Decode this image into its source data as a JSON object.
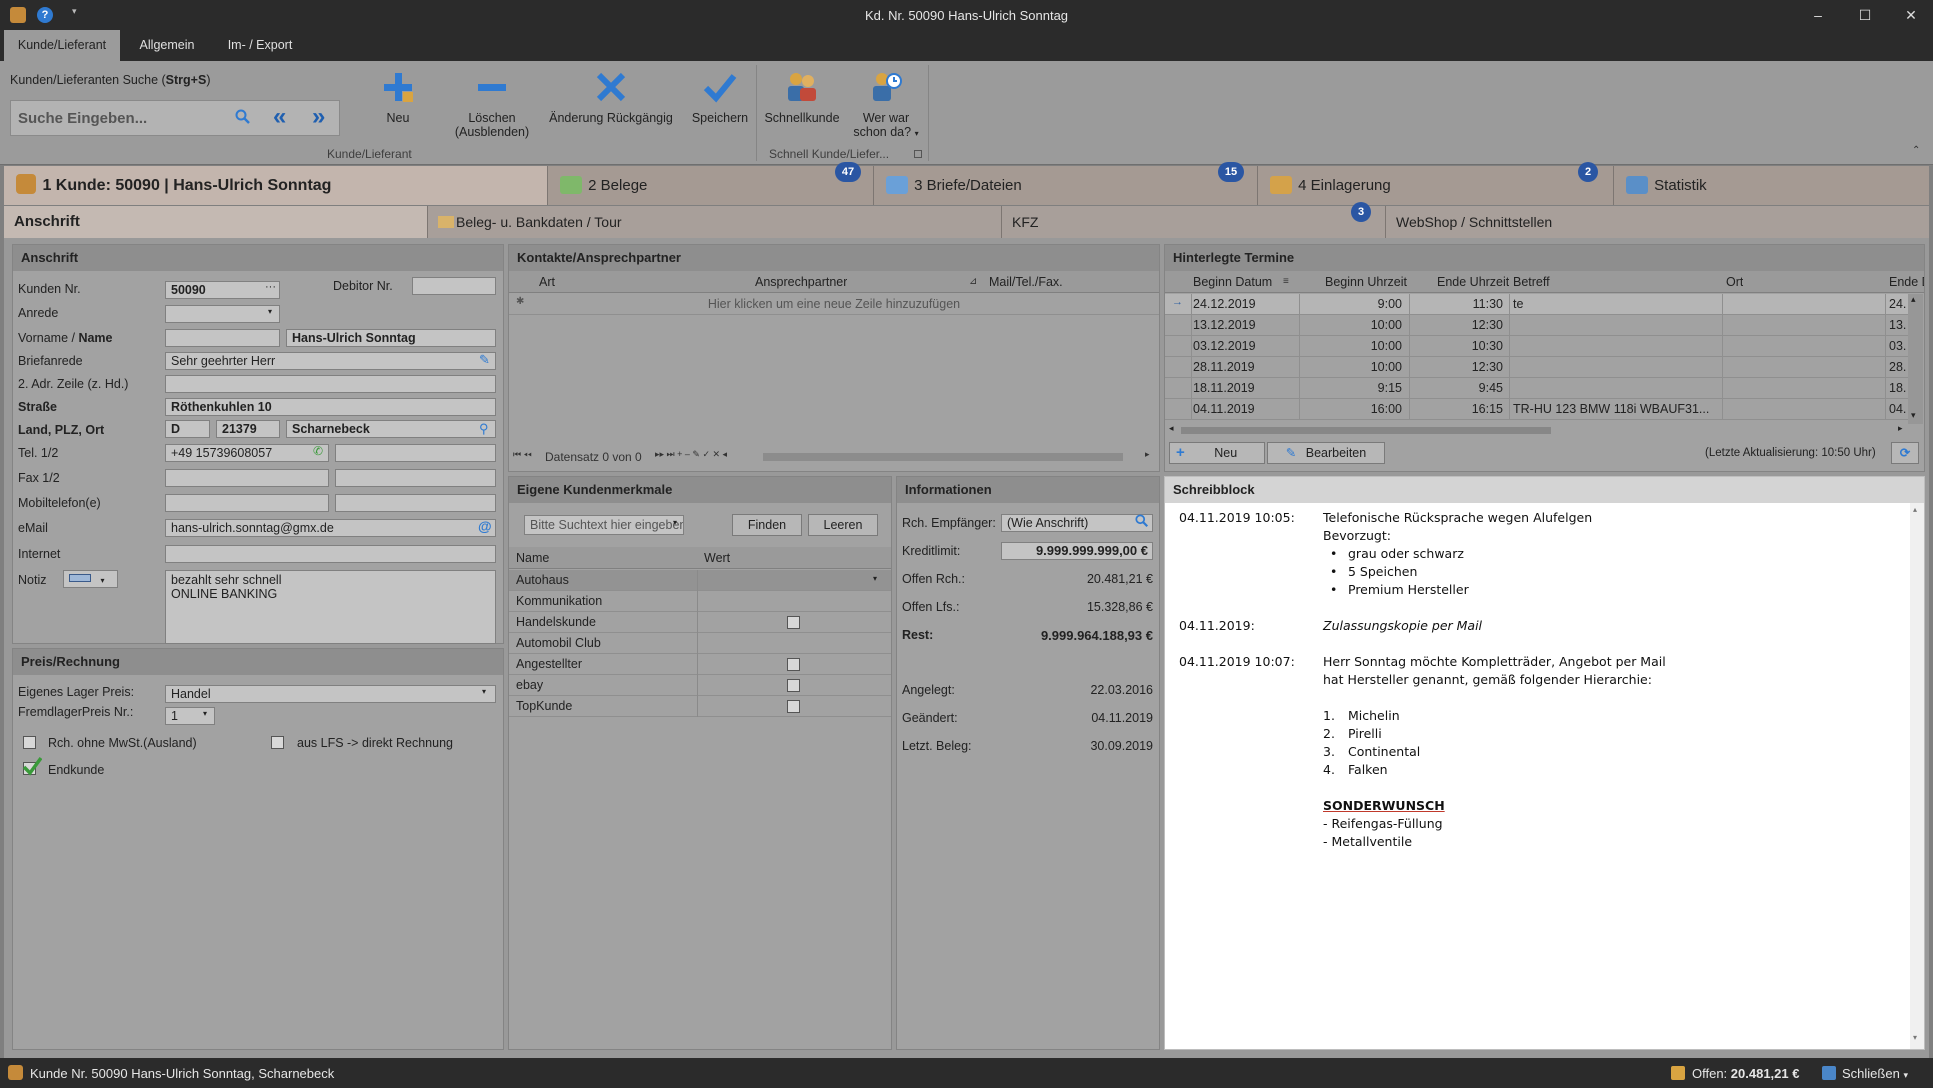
{
  "window": {
    "title": "Kd. Nr. 50090 Hans-Ulrich Sonntag",
    "minimize": "–",
    "maximize": "☐",
    "close": "✕"
  },
  "ribbon_tabs": [
    "Kunde/Lieferant",
    "Allgemein",
    "Im- / Export"
  ],
  "ribbon": {
    "search_label_pre": "Kunden/Lieferanten Suche (",
    "search_label_key": "Strg+S",
    "search_label_post": ")",
    "search_placeholder": "Suche Eingeben...",
    "buttons": {
      "neu": "Neu",
      "loeschen_1": "Löschen",
      "loeschen_2": "(Ausblenden)",
      "aenderung": "Änderung Rückgängig",
      "speichern": "Speichern",
      "schnellkunde": "Schnellkunde",
      "werwar_1": "Wer war",
      "werwar_2": "schon da?"
    },
    "group1": "Kunde/Lieferant",
    "group2": "Schnell Kunde/Liefer..."
  },
  "main_tabs": [
    {
      "label": "1 Kunde: 50090 | Hans-Ulrich Sonntag"
    },
    {
      "label": "2 Belege",
      "badge": "47"
    },
    {
      "label": "3 Briefe/Dateien",
      "badge": "15"
    },
    {
      "label": "4 Einlagerung",
      "badge": "2"
    },
    {
      "label": "Statistik"
    }
  ],
  "sub_tabs": [
    {
      "label": "Anschrift"
    },
    {
      "label": "Beleg- u. Bankdaten / Tour"
    },
    {
      "label": "KFZ",
      "badge": "3"
    },
    {
      "label": "WebShop / Schnittstellen"
    }
  ],
  "anschrift": {
    "header": "Anschrift",
    "kunden_nr_label": "Kunden Nr.",
    "kunden_nr": "50090",
    "debitor_label": "Debitor Nr.",
    "debitor": "",
    "anrede_label": "Anrede",
    "anrede": "",
    "vorname_label": "Vorname / ",
    "name_label": "Name",
    "vorname": "",
    "name": "Hans-Ulrich Sonntag",
    "briefanrede_label": "Briefanrede",
    "briefanrede": "Sehr geehrter Herr",
    "adr2_label": "2. Adr. Zeile (z. Hd.)",
    "adr2": "",
    "strasse_label": "Straße",
    "strasse": "Röthenkuhlen 10",
    "land_label": "Land, PLZ, Ort",
    "land": "D",
    "plz": "21379",
    "ort": "Scharnebeck",
    "tel_label": "Tel. 1/2",
    "tel1": "+49 15739608057",
    "tel2": "",
    "fax_label": "Fax 1/2",
    "mobil_label": "Mobiltelefon(e)",
    "email_label": "eMail",
    "email": "hans-ulrich.sonntag@gmx.de",
    "internet_label": "Internet",
    "notiz_label": "Notiz",
    "notiz_1": "bezahlt sehr schnell",
    "notiz_2": "ONLINE BANKING"
  },
  "preis": {
    "header": "Preis/Rechnung",
    "lager_label": "Eigenes Lager Preis:",
    "lager": "Handel",
    "fremd_label": "FremdlagerPreis Nr.:",
    "fremd": "1",
    "ohne_mwst": "Rch. ohne MwSt.(Ausland)",
    "lfs": "aus LFS -> direkt Rechnung",
    "endkunde": "Endkunde"
  },
  "kontakte": {
    "header": "Kontakte/Ansprechpartner",
    "columns": [
      "Art",
      "Ansprechpartner",
      "Mail/Tel./Fax."
    ],
    "add_row": "Hier klicken um eine neue Zeile hinzuzufügen",
    "nav": "Datensatz 0 von 0"
  },
  "merkmale": {
    "header": "Eigene Kundenmerkmale",
    "search_placeholder": "Bitte Suchtext hier eingeben...",
    "finden": "Finden",
    "leeren": "Leeren",
    "col_name": "Name",
    "col_wert": "Wert",
    "rows": [
      {
        "name": "Autohaus",
        "type": "dropdown"
      },
      {
        "name": "Kommunikation",
        "type": "none"
      },
      {
        "name": "Handelskunde",
        "type": "check"
      },
      {
        "name": "Automobil Club",
        "type": "none"
      },
      {
        "name": "Angestellter",
        "type": "check"
      },
      {
        "name": "ebay",
        "type": "check"
      },
      {
        "name": "TopKunde",
        "type": "check"
      }
    ]
  },
  "info": {
    "header": "Informationen",
    "empf_label": "Rch. Empfänger:",
    "empf": "(Wie Anschrift)",
    "kredit_label": "Kreditlimit:",
    "kredit": "9.999.999.999,00 €",
    "offen_rch_label": "Offen Rch.:",
    "offen_rch": "20.481,21 €",
    "offen_lfs_label": "Offen Lfs.:",
    "offen_lfs": "15.328,86 €",
    "rest_label": "Rest:",
    "rest": "9.999.964.188,93 €",
    "angelegt_label": "Angelegt:",
    "angelegt": "22.03.2016",
    "geaendert_label": "Geändert:",
    "geaendert": "04.11.2019",
    "letzt_label": "Letzt. Beleg:",
    "letzt": "30.09.2019"
  },
  "termine": {
    "header": "Hinterlegte Termine",
    "columns": [
      "Beginn Datum",
      "Beginn Uhrzeit",
      "Ende Uhrzeit",
      "Betreff",
      "Ort",
      "Ende D"
    ],
    "rows": [
      {
        "datum": "24.12.2019",
        "beginn": "9:00",
        "ende": "11:30",
        "betreff": "te",
        "ort": "",
        "ende_d": "24."
      },
      {
        "datum": "13.12.2019",
        "beginn": "10:00",
        "ende": "12:30",
        "betreff": "",
        "ort": "",
        "ende_d": "13."
      },
      {
        "datum": "03.12.2019",
        "beginn": "10:00",
        "ende": "10:30",
        "betreff": "",
        "ort": "",
        "ende_d": "03."
      },
      {
        "datum": "28.11.2019",
        "beginn": "10:00",
        "ende": "12:30",
        "betreff": "",
        "ort": "",
        "ende_d": "28."
      },
      {
        "datum": "18.11.2019",
        "beginn": "9:15",
        "ende": "9:45",
        "betreff": "",
        "ort": "",
        "ende_d": "18."
      },
      {
        "datum": "04.11.2019",
        "beginn": "16:00",
        "ende": "16:15",
        "betreff": "TR-HU 123 BMW 118i WBAUF31...",
        "ort": "",
        "ende_d": "04."
      }
    ],
    "neu": "Neu",
    "bearbeiten": "Bearbeiten",
    "update": "(Letzte Aktualisierung: 10:50 Uhr)"
  },
  "schreibblock": {
    "header": "Schreibblock",
    "e1_date": "04.11.2019 10:05:",
    "e1_text": "Telefonische Rücksprache wegen Alufelgen",
    "e1_sub": "Bevorzugt:",
    "e1_bullets": [
      "grau oder schwarz",
      "5 Speichen",
      "Premium Hersteller"
    ],
    "e2_date": "04.11.2019:",
    "e2_text": "Zulassungskopie per Mail",
    "e3_date": "04.11.2019 10:07:",
    "e3_text1": "Herr Sonntag möchte Kompletträder, Angebot per Mail",
    "e3_text2": "hat Hersteller genannt, gemäß folgender Hierarchie:",
    "e3_list": [
      "Michelin",
      "Pirelli",
      "Continental",
      "Falken"
    ],
    "sonder": "SONDERWUNSCH",
    "sonder_items": [
      "- Reifengas-Füllung",
      "- Metallventile"
    ]
  },
  "statusbar": {
    "left": "Kunde Nr. 50090 Hans-Ulrich Sonntag, Scharnebeck",
    "offen_label": "Offen: ",
    "offen": "20.481,21 €",
    "schliessen": "Schließen"
  }
}
